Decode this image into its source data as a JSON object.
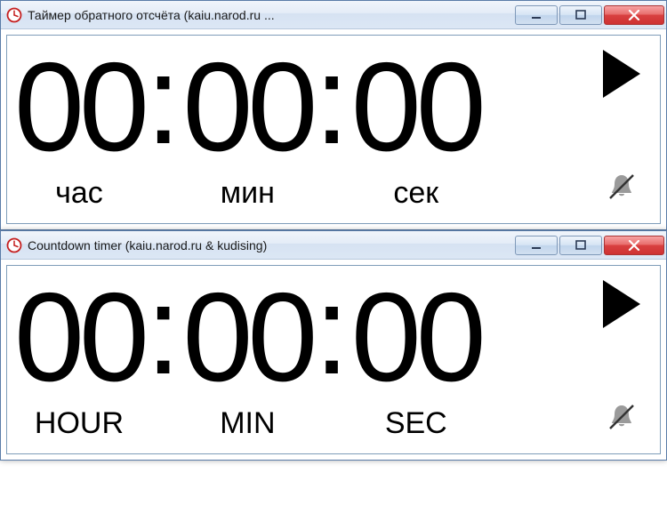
{
  "windows": [
    {
      "title": "Таймер обратного отсчёта (kaiu.narod.ru ...",
      "hours": "00",
      "minutes": "00",
      "seconds": "00",
      "label_hours": "час",
      "label_minutes": "мин",
      "label_seconds": "сек"
    },
    {
      "title": "Countdown timer (kaiu.narod.ru & kudising)",
      "hours": "00",
      "minutes": "00",
      "seconds": "00",
      "label_hours": "HOUR",
      "label_minutes": "MIN",
      "label_seconds": "SEC"
    }
  ],
  "separator": ":"
}
